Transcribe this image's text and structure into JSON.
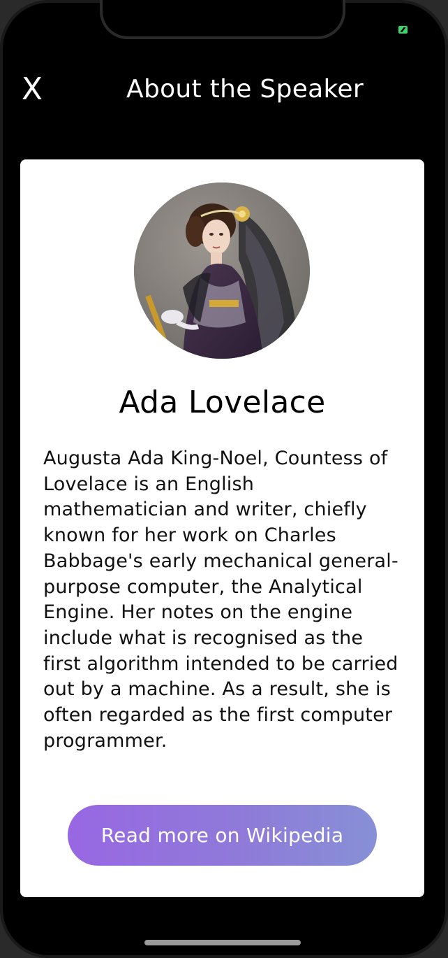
{
  "status_bar": {
    "battery_icon": "battery-charging-icon",
    "battery_color": "#3fd36b"
  },
  "header": {
    "close_label": "X",
    "title": "About the Speaker"
  },
  "speaker": {
    "photo_icon": "speaker-portrait",
    "name": "Ada Lovelace",
    "bio": "Augusta Ada King-Noel, Countess of Lovelace is an English mathematician and writer, chiefly known for her work on Charles Babbage's early mechanical general-purpose computer, the Analytical Engine. Her notes on the engine include what is recognised as the first algorithm intended to be carried out by a machine. As a result, she is often regarded as the first computer programmer.",
    "wiki_button_label": "Read more on Wikipedia"
  },
  "colors": {
    "background": "#000000",
    "card": "#ffffff",
    "button_gradient_start": "#9867e3",
    "button_gradient_end": "#8790d6"
  }
}
